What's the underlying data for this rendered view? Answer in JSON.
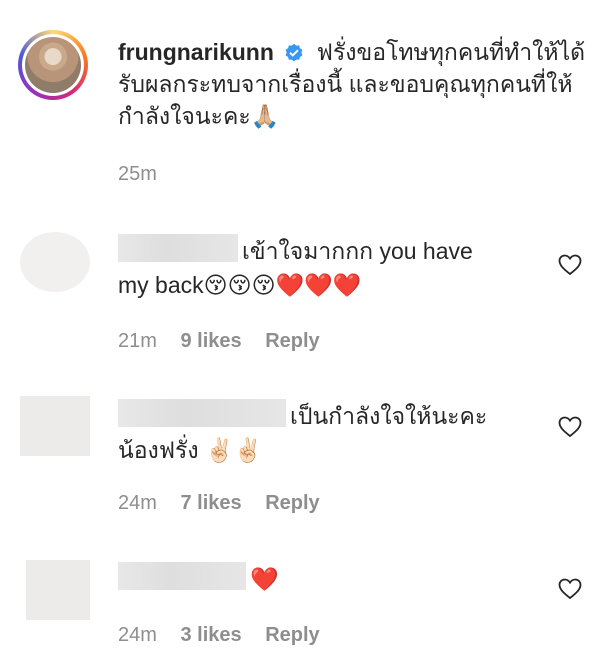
{
  "post": {
    "username": "frungnarikunn",
    "caption": "ฟรั่งขอโทษทุกคนที่ทำให้ได้รับผลกระทบจากเรื่องนี้ และขอบคุณทุกคนที่ให้กำลังใจนะคะ🙏🏼",
    "time": "25m",
    "verified_icon": "verified-badge-icon"
  },
  "comments": [
    {
      "text_line1": "เข้าใจมากกก you have",
      "text_line2": "my back😚😚😚❤️❤️❤️",
      "time": "21m",
      "likes": "9 likes",
      "reply": "Reply"
    },
    {
      "text_line1": "เป็นกำลังใจให้นะคะ",
      "text_line2": "น้องฟรั่ง ✌🏻✌🏻",
      "time": "24m",
      "likes": "7 likes",
      "reply": "Reply"
    },
    {
      "text_line1": "❤️",
      "time": "24m",
      "likes": "3 likes",
      "reply": "Reply"
    }
  ],
  "colors": {
    "text": "#262626",
    "meta": "#8e8e8e",
    "verified": "#3897f0"
  },
  "icons": [
    "heart-outline-icon"
  ]
}
